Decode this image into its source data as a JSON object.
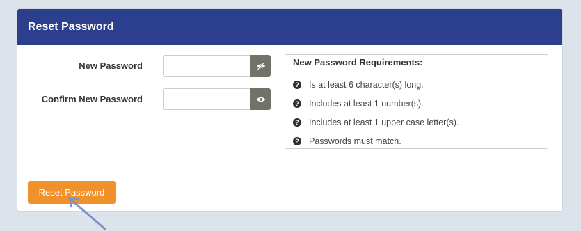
{
  "panel": {
    "title": "Reset Password"
  },
  "form": {
    "new_password": {
      "label": "New Password",
      "value": "",
      "toggle_icon": "eye-slash-icon"
    },
    "confirm_password": {
      "label": "Confirm New Password",
      "value": "",
      "toggle_icon": "eye-icon"
    }
  },
  "requirements": {
    "title": "New Password Requirements:",
    "items": [
      {
        "text": "Is at least 6 character(s) long.",
        "icon": "question-circle-icon"
      },
      {
        "text": "Includes at least 1 number(s).",
        "icon": "question-circle-icon"
      },
      {
        "text": "Includes at least 1 upper case letter(s).",
        "icon": "question-circle-icon"
      },
      {
        "text": "Passwords must match.",
        "icon": "question-circle-icon"
      }
    ]
  },
  "actions": {
    "reset_label": "Reset Password"
  },
  "colors": {
    "header_bg": "#2b3f8e",
    "button_bg": "#f0922b",
    "toggle_bg": "#707468",
    "page_bg": "#dde3ea",
    "cursor": "#8090c8"
  }
}
